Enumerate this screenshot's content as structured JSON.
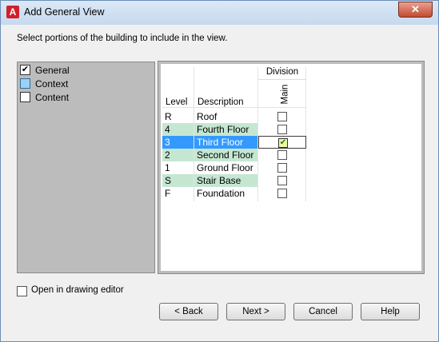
{
  "window": {
    "title": "Add General View",
    "app_icon_letter": "A",
    "close_symbol": "✕"
  },
  "instruction": "Select portions of the building to include in the view.",
  "left_list": [
    {
      "label": "General",
      "state": "checked",
      "mark": "✔"
    },
    {
      "label": "Context",
      "state": "partial",
      "mark": ""
    },
    {
      "label": "Content",
      "state": "unchecked",
      "mark": ""
    }
  ],
  "grid": {
    "group_header": "Division",
    "col_level": "Level",
    "col_desc": "Description",
    "col_main": "Main",
    "rows": [
      {
        "level": "R",
        "desc": "Roof",
        "checked": false,
        "mark": "",
        "style": "plain"
      },
      {
        "level": "4",
        "desc": "Fourth Floor",
        "checked": false,
        "mark": "",
        "style": "green"
      },
      {
        "level": "3",
        "desc": "Third Floor",
        "checked": true,
        "mark": "✔",
        "style": "sel"
      },
      {
        "level": "2",
        "desc": "Second Floor",
        "checked": false,
        "mark": "",
        "style": "green"
      },
      {
        "level": "1",
        "desc": "Ground Floor",
        "checked": false,
        "mark": "",
        "style": "plain"
      },
      {
        "level": "S",
        "desc": "Stair Base",
        "checked": false,
        "mark": "",
        "style": "green"
      },
      {
        "level": "F",
        "desc": "Foundation",
        "checked": false,
        "mark": "",
        "style": "plain"
      }
    ]
  },
  "open_in_editor": {
    "label": "Open in drawing editor",
    "checked": false
  },
  "buttons": {
    "back": "< Back",
    "next": "Next >",
    "cancel": "Cancel",
    "help": "Help"
  },
  "colors": {
    "row_green": "#c5e7d2",
    "row_selected": "#3399ff",
    "panel_gray": "#bcbcbc"
  }
}
